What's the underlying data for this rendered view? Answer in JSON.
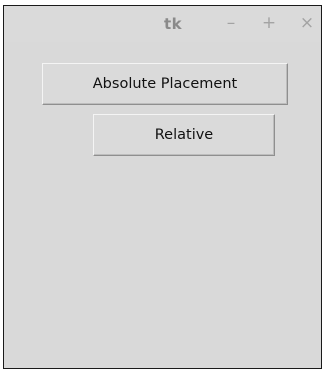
{
  "window": {
    "title": "tk",
    "controls": {
      "minimize": "–",
      "maximize": "+",
      "close": "×"
    }
  },
  "buttons": {
    "absolute_label": "Absolute Placement",
    "relative_label": "Relative"
  }
}
